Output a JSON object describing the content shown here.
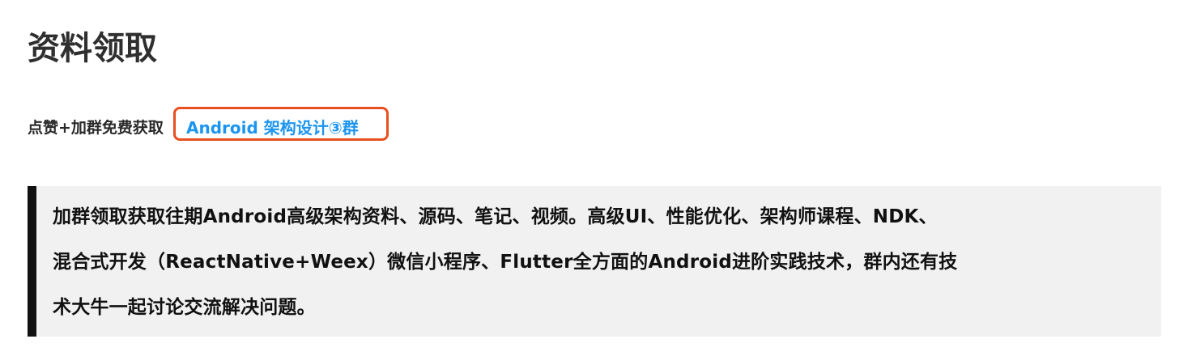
{
  "heading": {
    "title": "资料领取"
  },
  "intro": {
    "text": "点赞+加群免费获取",
    "link_label": "Android 架构设计③群"
  },
  "quote": {
    "line1": "加群领取获取往期Android高级架构资料、源码、笔记、视频。高级UI、性能优化、架构师课程、NDK、",
    "line2": "混合式开发（ReactNative+Weex）微信小程序、Flutter全方面的Android进阶实践技术，群内还有技",
    "line3": "术大牛一起讨论交流解决问题。"
  },
  "colors": {
    "link": "#1b95f0",
    "highlight_border": "#e8501f",
    "quote_background": "#f1f1f1",
    "quote_bar": "#111111"
  }
}
